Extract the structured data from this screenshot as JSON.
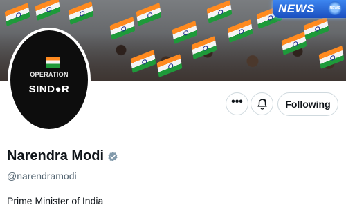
{
  "badge": {
    "label": "NEWS",
    "mini_label": "NEWS"
  },
  "avatar": {
    "line1": "OPERATION",
    "line2": "SIND●R"
  },
  "actions": {
    "more_label": "•••",
    "follow_label": "Following"
  },
  "profile": {
    "name": "Narendra Modi",
    "handle": "@narendramodi",
    "bio": "Prime Minister of India"
  },
  "icons": {
    "more": "more-icon",
    "notify": "bell-plus-icon",
    "verified": "verified-badge-icon"
  },
  "colors": {
    "verified": "#829aab",
    "text": "#0f1419",
    "muted": "#536471",
    "border": "#cfd9de",
    "saffron": "#ff8a1f",
    "green": "#1e9a3a"
  }
}
